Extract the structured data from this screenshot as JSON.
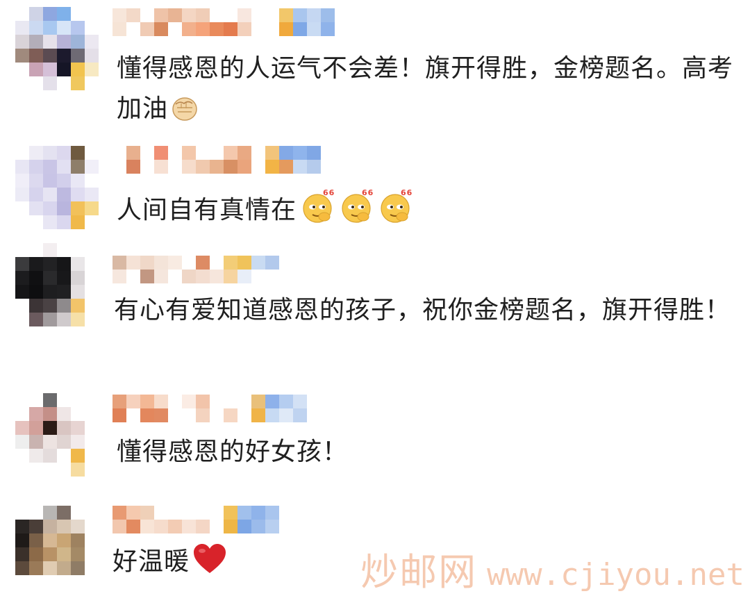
{
  "comments": [
    {
      "text": "懂得感恩的人运气不会差！旗开得胜，金榜题名。高考加油",
      "emoji": "fist-emoji"
    },
    {
      "text": "人间自有真情在",
      "emoji": "awesome-666-emoji",
      "emoji_badge": "666"
    },
    {
      "text": "有心有爱知道感恩的孩子，祝你金榜题名，旗开得胜！"
    },
    {
      "text": "懂得感恩的好女孩！"
    },
    {
      "text": "好温暖",
      "emoji": "heart-emoji"
    }
  ],
  "watermark": {
    "site_name": "炒邮网",
    "url": "www.cjiyou.net"
  },
  "colors": {
    "text": "#1f1f1f",
    "watermark": "#f5c9b0",
    "heart": "#d8232a"
  }
}
